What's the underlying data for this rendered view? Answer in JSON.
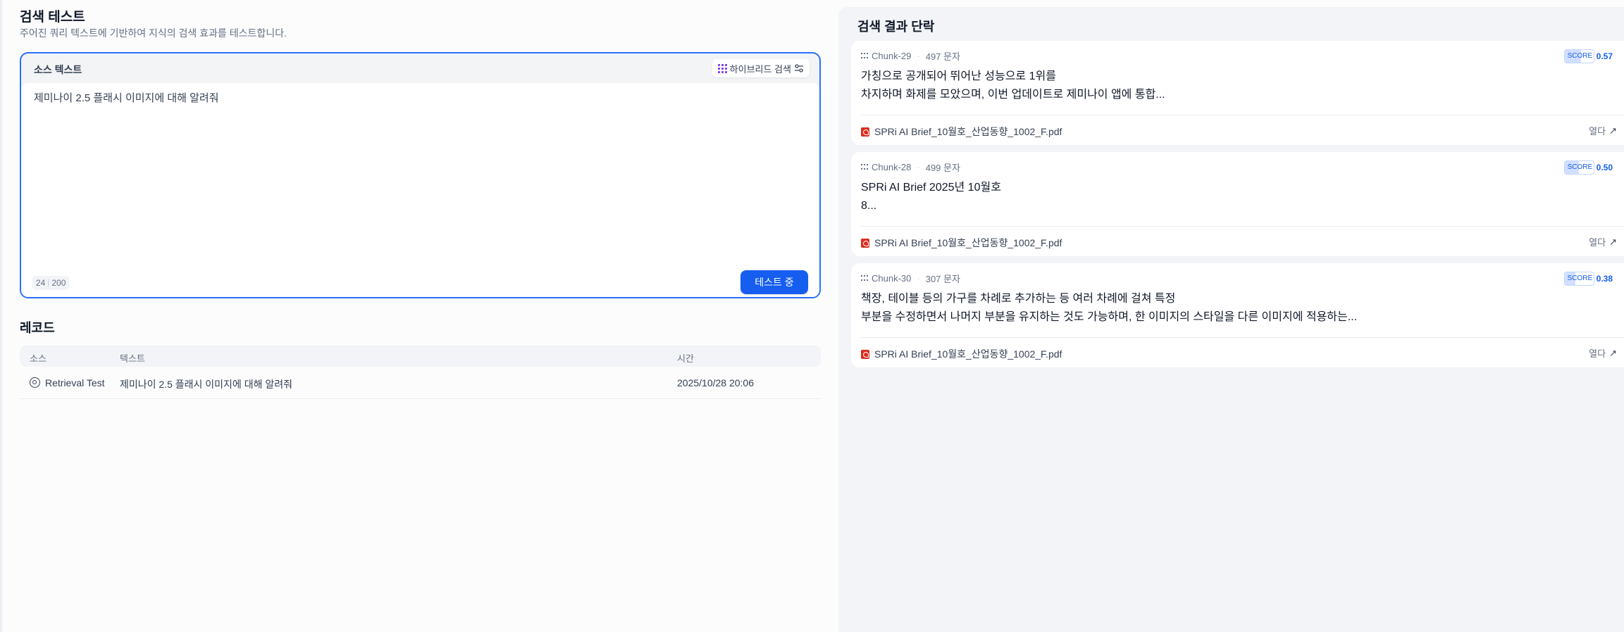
{
  "page": {
    "title": "검색 테스트",
    "description": "주어진 쿼리 텍스트에 기반하여 지식의 검색 효과를 테스트합니다."
  },
  "query": {
    "label": "소스 텍스트",
    "method_label": "하이브리드 검색",
    "text": "제미나이 2.5 플래시 이미지에 대해 알려줘",
    "char_count": "24",
    "char_limit": "200",
    "test_button": "테스트 중"
  },
  "records": {
    "title": "레코드",
    "columns": [
      "소스",
      "텍스트",
      "시간"
    ],
    "rows": [
      {
        "source": "Retrieval Test",
        "text": "제미나이 2.5 플래시 이미지에 대해 알려줘",
        "time": "2025/10/28 20:06"
      }
    ]
  },
  "results": {
    "title": "검색 결과 단락",
    "open_label": "열다",
    "score_label": "SCORE",
    "items": [
      {
        "chunk": "Chunk-29",
        "chars": "497 문자",
        "score": "0.57",
        "score_value": 0.57,
        "line1": "가칭으로 공개되어 뛰어난 성능으로 1위를",
        "line2": "차지하며 화제를 모았으며, 이번 업데이트로 제미나이 앱에 통합...",
        "file": "SPRi AI Brief_10월호_산업동향_1002_F.pdf"
      },
      {
        "chunk": "Chunk-28",
        "chars": "499 문자",
        "score": "0.50",
        "score_value": 0.5,
        "line1": "SPRi AI Brief 2025년 10월호",
        "line2": "8...",
        "file": "SPRi AI Brief_10월호_산업동향_1002_F.pdf"
      },
      {
        "chunk": "Chunk-30",
        "chars": "307 문자",
        "score": "0.38",
        "score_value": 0.38,
        "line1": "책장, 테이블 등의 가구를 차례로 추가하는 등 여러 차례에 걸쳐 특정",
        "line2": "부분을 수정하면서 나머지 부분을 유지하는 것도 가능하며, 한 이미지의 스타일을 다른 이미지에 적용하는...",
        "file": "SPRi AI Brief_10월호_산업동향_1002_F.pdf"
      }
    ]
  },
  "colors": {
    "accent": "#155eef",
    "border_focus": "#2970ff",
    "pdf": "#d92d20",
    "method_icon": "#7839ee"
  },
  "icons": {
    "method": "hybrid-search-grid-icon",
    "settings": "sliders-icon",
    "record_source": "target-icon",
    "chunk": "dots-grid-icon",
    "file": "pdf-icon",
    "open": "arrow-up-right-icon"
  }
}
